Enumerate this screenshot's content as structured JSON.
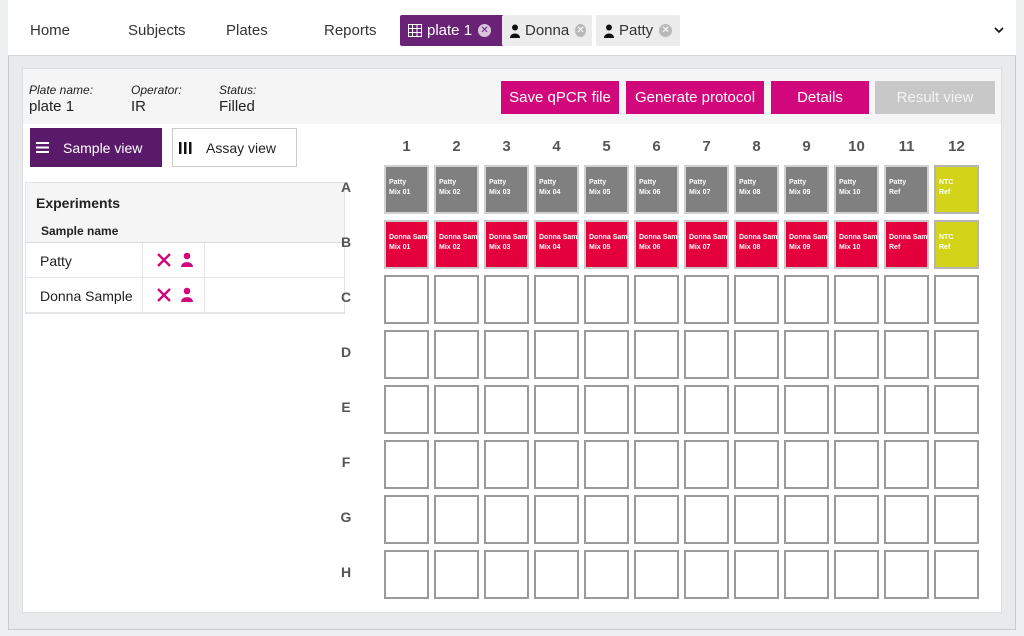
{
  "nav": {
    "links": [
      "Home",
      "Subjects",
      "Plates",
      "Reports"
    ],
    "tabs": [
      {
        "label": "plate 1",
        "icon": "plate-grid-icon",
        "active": true
      },
      {
        "label": "Donna",
        "icon": "person-icon",
        "active": false
      },
      {
        "label": "Patty",
        "icon": "person-icon",
        "active": false
      }
    ]
  },
  "plate_info": {
    "name_label": "Plate name:",
    "name": "plate 1",
    "operator_label": "Operator:",
    "operator": "IR",
    "status_label": "Status:",
    "status": "Filled"
  },
  "actions": {
    "save": "Save qPCR file",
    "generate": "Generate protocol",
    "details": "Details",
    "result": "Result view"
  },
  "views": {
    "sample": "Sample view",
    "assay": "Assay view"
  },
  "experiments": {
    "title": "Experiments",
    "column_header": "Sample name",
    "rows": [
      "Patty",
      "Donna Sample"
    ]
  },
  "plate": {
    "columns": [
      "1",
      "2",
      "3",
      "4",
      "5",
      "6",
      "7",
      "8",
      "9",
      "10",
      "11",
      "12"
    ],
    "rows": [
      "A",
      "B",
      "C",
      "D",
      "E",
      "F",
      "G",
      "H"
    ],
    "filled": [
      [
        "Patty|Mix 01",
        "Patty|Mix 02",
        "Patty|Mix 03",
        "Patty|Mix 04",
        "Patty|Mix 05",
        "Patty|Mix 06",
        "Patty|Mix 07",
        "Patty|Mix 08",
        "Patty|Mix 09",
        "Patty|Mix 10",
        "Patty|Ref",
        "NTC|Ref"
      ],
      [
        "Donna Sam|Mix 01",
        "Donna Sam|Mix 02",
        "Donna Sam|Mix 03",
        "Donna Sam|Mix 04",
        "Donna Sam|Mix 05",
        "Donna Sam|Mix 06",
        "Donna Sam|Mix 07",
        "Donna Sam|Mix 08",
        "Donna Sam|Mix 09",
        "Donna Sam|Mix 10",
        "Donna Sam|Ref",
        "NTC|Ref"
      ]
    ]
  },
  "colors": {
    "accent": "#d1087c",
    "purple": "#6a2277",
    "patty_well": "#808080",
    "donna_well": "#e3003d",
    "ntc_well": "#d3d41a"
  }
}
